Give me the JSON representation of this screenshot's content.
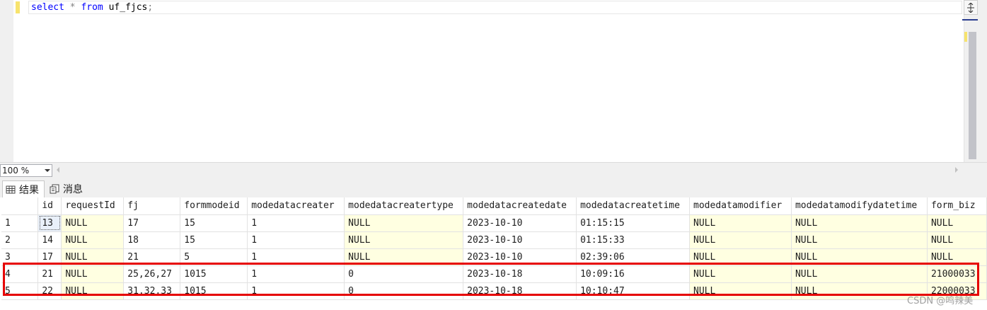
{
  "editor": {
    "query_tokens": [
      "select",
      "*",
      "from",
      "uf_fjcs",
      ";"
    ]
  },
  "zoom": {
    "value": "100 %"
  },
  "tabs": {
    "results_label": "结果",
    "messages_label": "消息"
  },
  "grid": {
    "columns": [
      "",
      "id",
      "requestId",
      "fj",
      "formmodeid",
      "modedatacreater",
      "modedatacreatertype",
      "modedatacreatedate",
      "modedatacreatetime",
      "modedatamodifier",
      "modedatamodifydatetime",
      "form_biz"
    ],
    "rows": [
      [
        "1",
        "13",
        "NULL",
        "17",
        "15",
        "1",
        "NULL",
        "2023-10-10",
        "01:15:15",
        "NULL",
        "NULL",
        "NULL"
      ],
      [
        "2",
        "14",
        "NULL",
        "18",
        "15",
        "1",
        "NULL",
        "2023-10-10",
        "01:15:33",
        "NULL",
        "NULL",
        "NULL"
      ],
      [
        "3",
        "17",
        "NULL",
        "21",
        "5",
        "1",
        "NULL",
        "2023-10-10",
        "02:39:06",
        "NULL",
        "NULL",
        "NULL"
      ],
      [
        "4",
        "21",
        "NULL",
        "25,26,27",
        "1015",
        "1",
        "0",
        "2023-10-18",
        "10:09:16",
        "NULL",
        "NULL",
        "21000033"
      ],
      [
        "5",
        "22",
        "NULL",
        "31,32,33",
        "1015",
        "1",
        "0",
        "2023-10-18",
        "10:10:47",
        "NULL",
        "NULL",
        "22000033"
      ]
    ]
  },
  "watermark": "CSDN @鸣辣美",
  "colors": {
    "keyword": "#0000ff",
    "null_cell": "#ffffe1",
    "highlight_box": "#e60000"
  }
}
